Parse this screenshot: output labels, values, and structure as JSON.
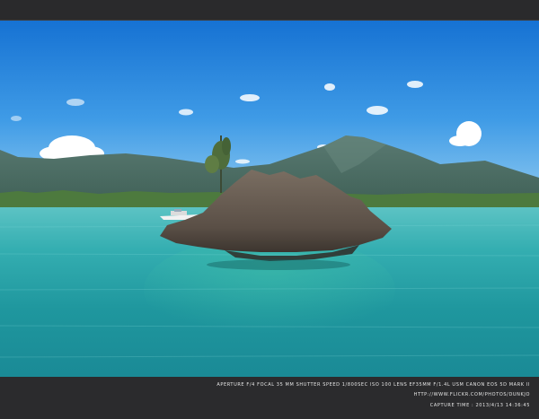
{
  "image": {
    "description_colors": {
      "sky_top": "#1a78d6",
      "sky_horizon": "#7fc0ee",
      "water_far": "#3bb7b5",
      "water_near": "#1c8f9a",
      "mountain": "#4a6e66",
      "rock": "#6b5f55"
    }
  },
  "caption": {
    "exif": "Aperture f/4   Focal 35 mm   Shutter speed 1/800sec   ISO 100   Lens EF35mm f/1.4L USM   Canon EOS 5D Mark II",
    "url": "http://www.flickr.com/photos/dunkjo",
    "capture_time": "Capture Time : 2013/4/13 14:36:45"
  }
}
